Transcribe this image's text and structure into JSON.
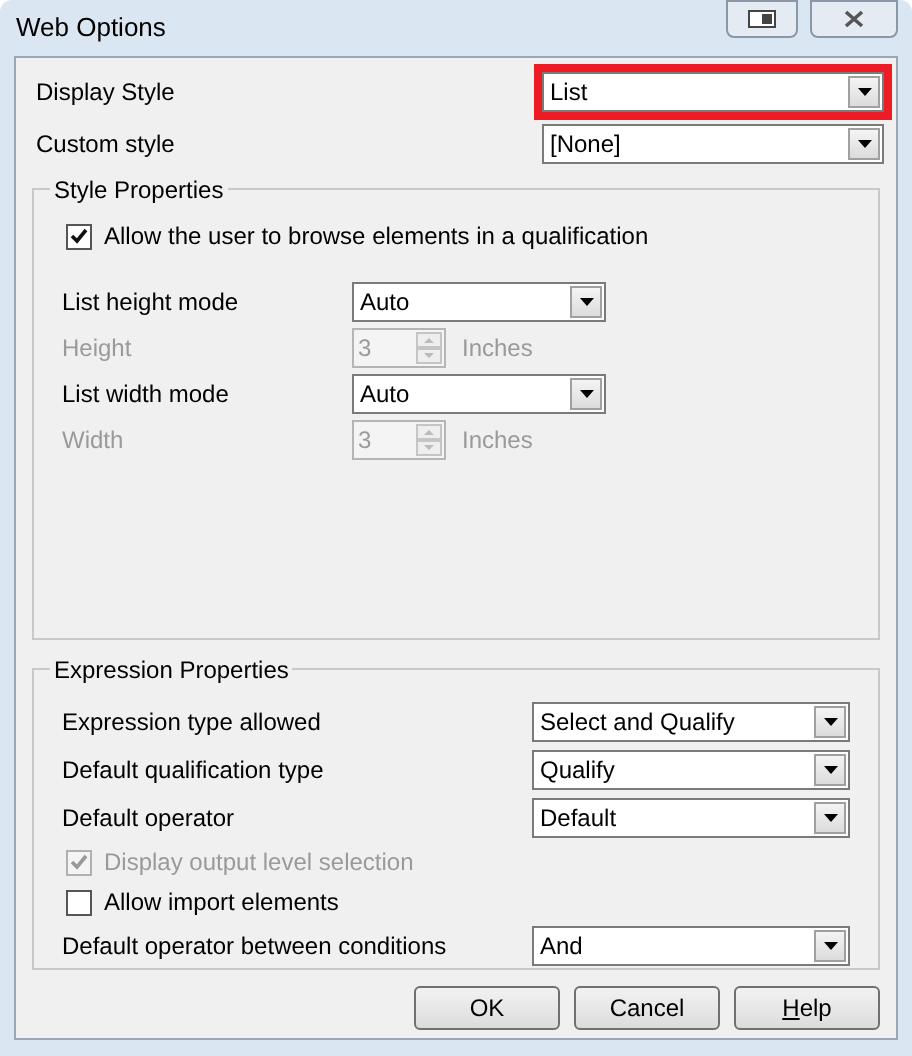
{
  "window": {
    "title": "Web Options"
  },
  "top_fields": [
    {
      "label": "Display Style",
      "value": "List",
      "highlighted": true
    },
    {
      "label": "Custom style",
      "value": "[None]",
      "highlighted": false
    }
  ],
  "style_properties": {
    "title": "Style Properties",
    "browse_checkbox": {
      "label": "Allow the user to browse elements in a qualification",
      "checked": true,
      "disabled": false
    },
    "rows": [
      {
        "kind": "combo",
        "label": "List height mode",
        "value": "Auto",
        "disabled": false
      },
      {
        "kind": "spin",
        "label": "Height",
        "value": "3",
        "unit": "Inches",
        "disabled": true
      },
      {
        "kind": "combo",
        "label": "List width mode",
        "value": "Auto",
        "disabled": false
      },
      {
        "kind": "spin",
        "label": "Width",
        "value": "3",
        "unit": "Inches",
        "disabled": true
      }
    ]
  },
  "expression_properties": {
    "title": "Expression Properties",
    "rows": [
      {
        "kind": "combo",
        "label": "Expression type allowed",
        "value": "Select and Qualify"
      },
      {
        "kind": "combo",
        "label": "Default qualification type",
        "value": "Qualify"
      },
      {
        "kind": "combo",
        "label": "Default operator",
        "value": "Default"
      },
      {
        "kind": "checkbox",
        "label": "Display output level selection",
        "checked": true,
        "disabled": true
      },
      {
        "kind": "checkbox",
        "label": "Allow import elements",
        "checked": false,
        "disabled": false
      },
      {
        "kind": "combo",
        "label": "Default operator between conditions",
        "value": "And"
      }
    ]
  },
  "buttons": [
    {
      "label": "OK",
      "mnemonic_first": false
    },
    {
      "label": "Cancel",
      "mnemonic_first": false
    },
    {
      "label": "Help",
      "mnemonic_first": true
    }
  ]
}
